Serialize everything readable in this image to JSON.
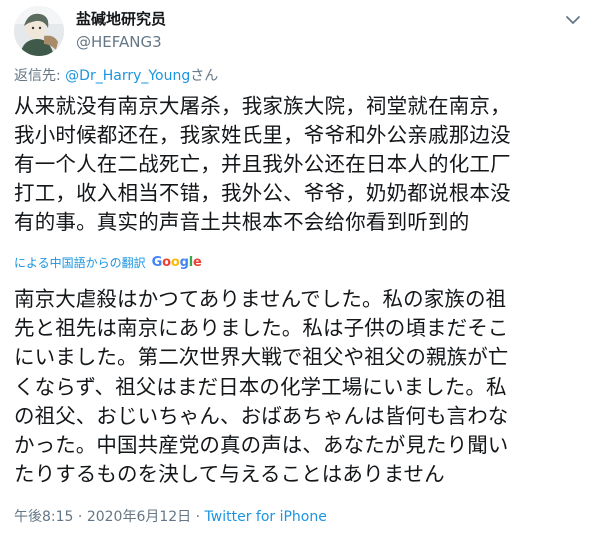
{
  "user": {
    "display_name": "盐碱地研究员",
    "handle": "@HEFANG3"
  },
  "reply": {
    "prefix": "返信先: ",
    "mention": "@Dr_Harry_Young",
    "suffix": "さん"
  },
  "tweet": {
    "lines_zh": [
      "从来就没有南京大屠杀，我家族大院，祠堂就在南京，",
      "我小时候都还在，我家姓氏里，爷爷和外公亲戚那边没",
      "有一个人在二战死亡，并且我外公还在日本人的化工厂",
      "打工，收入相当不错，我外公、爷爷，奶奶都说根本没",
      "有的事。真实的声音土共根本不会给你看到听到的"
    ],
    "translation_label": "による中国語からの翻訳",
    "translation_provider": "Google",
    "lines_ja": [
      "南京大虐殺はかつてありませんでした。私の家族の祖",
      "先と祖先は南京にありました。私は子供の頃まだそこ",
      "にいました。第二次世界大戦で祖父や祖父の親族が亡",
      "くならず、祖父はまだ日本の化学工場にいました。私",
      "の祖父、おじいちゃん、おばあちゃんは皆何も言わな",
      "かった。中国共産党の真の声は、あなたが見たり聞い",
      "たりするものを決して与えることはありません"
    ]
  },
  "meta": {
    "time": "午後8:15",
    "separator": " · ",
    "date": "2020年6月12日",
    "source": "Twitter for iPhone"
  },
  "icons": {
    "avatar": "avatar",
    "caret": "chevron-down-icon"
  },
  "colors": {
    "link": "#1b95e0",
    "secondary_text": "#657786",
    "primary_text": "#14171a"
  }
}
